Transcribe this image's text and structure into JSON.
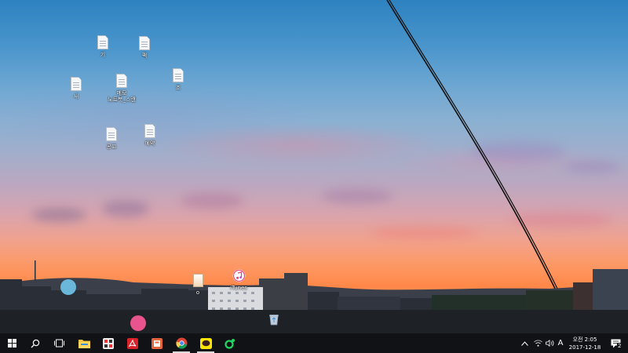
{
  "desktop": {
    "icons": [
      {
        "id": "doc-1",
        "label": "기"
      },
      {
        "id": "doc-2",
        "label": "팩"
      },
      {
        "id": "doc-3",
        "label": "새"
      },
      {
        "id": "doc-4",
        "label": "메모\n노트북_스캔"
      },
      {
        "id": "doc-5",
        "label": "조"
      },
      {
        "id": "doc-6",
        "label": "공고"
      },
      {
        "id": "doc-7",
        "label": "예약"
      },
      {
        "id": "file-8",
        "label": "o"
      },
      {
        "id": "itunes",
        "label": "iTunes"
      }
    ]
  },
  "taskbar": {
    "pinned": [
      {
        "name": "file-explorer",
        "active": false
      },
      {
        "name": "photo-app",
        "active": false
      },
      {
        "name": "adobe-acrobat",
        "active": false
      },
      {
        "name": "powerpoint",
        "active": false
      },
      {
        "name": "chrome",
        "active": true
      },
      {
        "name": "kakaotalk",
        "active": true
      },
      {
        "name": "green-app",
        "active": false
      }
    ],
    "tray": {
      "ime_indicator": "A",
      "time": "오전 2:05",
      "date": "2017-12-18",
      "notification_count": "2"
    }
  },
  "colors": {
    "taskbar": "#101216",
    "accent": "#ffffff"
  }
}
